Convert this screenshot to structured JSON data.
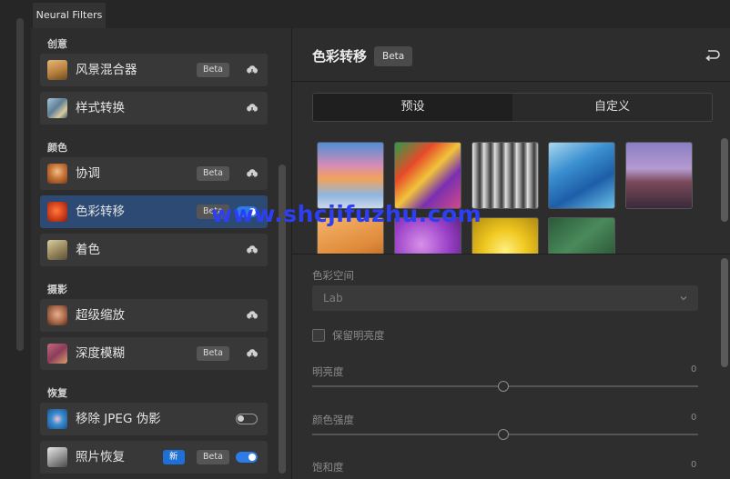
{
  "window": {
    "tab_title": "Neural Filters"
  },
  "groups": [
    {
      "title": "创意",
      "items": [
        {
          "name": "风景混合器",
          "badge": "Beta",
          "action": "cloud",
          "thumb": "landscape"
        },
        {
          "name": "样式转换",
          "action": "cloud",
          "thumb": "style"
        }
      ]
    },
    {
      "title": "颜色",
      "items": [
        {
          "name": "协调",
          "badge": "Beta",
          "action": "cloud",
          "thumb": "harmonize"
        },
        {
          "name": "色彩转移",
          "badge": "Beta",
          "action": "toggle-on",
          "selected": true,
          "thumb": "colortransfer"
        },
        {
          "name": "着色",
          "action": "cloud",
          "thumb": "colorize"
        }
      ]
    },
    {
      "title": "摄影",
      "items": [
        {
          "name": "超级缩放",
          "action": "cloud",
          "thumb": "superzoom"
        },
        {
          "name": "深度模糊",
          "badge": "Beta",
          "action": "cloud",
          "thumb": "depthblur"
        }
      ]
    },
    {
      "title": "恢复",
      "items": [
        {
          "name": "移除 JPEG 伪影",
          "action": "toggle-off",
          "thumb": "jpeg"
        },
        {
          "name": "照片恢复",
          "badge_new": "新",
          "badge": "Beta",
          "action": "toggle-on",
          "thumb": "restore"
        }
      ]
    }
  ],
  "detail": {
    "title": "色彩转移",
    "badge": "Beta",
    "segments": {
      "preset": "预设",
      "custom": "自定义"
    },
    "color_space_label": "色彩空间",
    "color_space_value": "Lab",
    "preserve_luminance": "保留明亮度",
    "sliders": [
      {
        "label": "明亮度",
        "value": "0"
      },
      {
        "label": "颜色强度",
        "value": "0"
      },
      {
        "label": "饱和度",
        "value": "0"
      }
    ]
  },
  "watermark": "www.shcjifuzhu.com",
  "colors": {
    "accent": "#2c7be6",
    "selected": "#2c4a73",
    "watermark": "#2d3ff5"
  }
}
